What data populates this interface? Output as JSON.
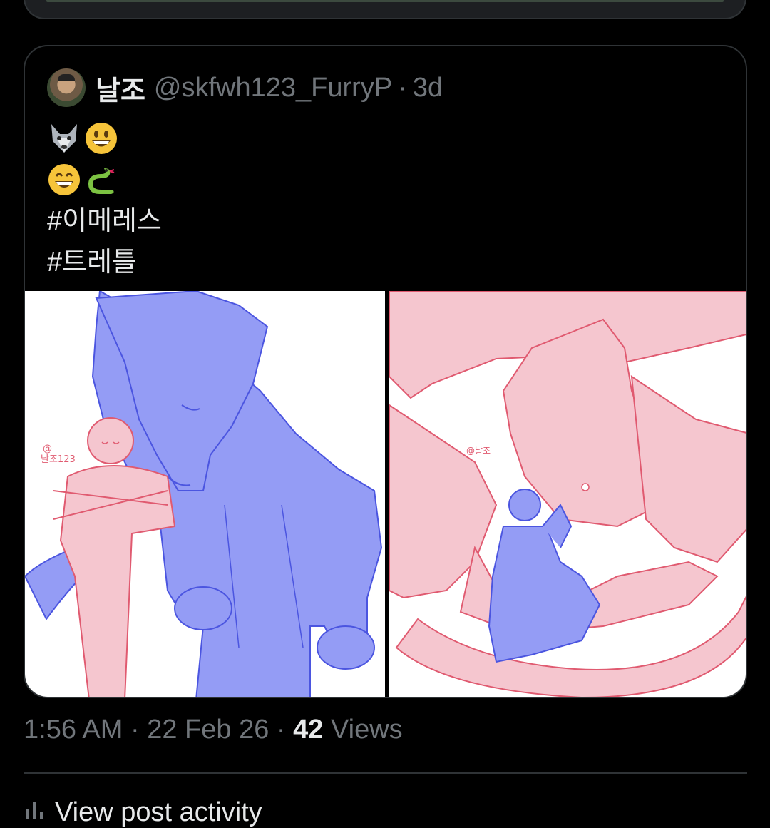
{
  "post": {
    "author_name": "날조",
    "author_handle": "@skfwh123_FurryP",
    "dot": "·",
    "age": "3d",
    "hashtag_1": "#이메레스",
    "hashtag_2": "#트레틀",
    "emojis": [
      "wolf-emoji",
      "grinning-face-emoji",
      "smiling-face-emoji",
      "snake-emoji"
    ]
  },
  "media": [
    {
      "label": "wolf-and-person-drawing",
      "signature": "@\n날조123"
    },
    {
      "label": "dragon-and-person-drawing",
      "signature": "@날조"
    }
  ],
  "meta": {
    "time": "1:56 AM",
    "sep1": "·",
    "date": "22 Feb 26",
    "sep2": "·",
    "views_count": "42",
    "views_label": "Views"
  },
  "activity": {
    "label": "View post activity",
    "icon": "bar-chart-icon"
  },
  "colors": {
    "background": "#000000",
    "text": "#e7e9ea",
    "secondary": "#71767b",
    "border": "#2f3336",
    "blue_figure": "#949cf5",
    "pink_figure": "#f5c6cf"
  }
}
